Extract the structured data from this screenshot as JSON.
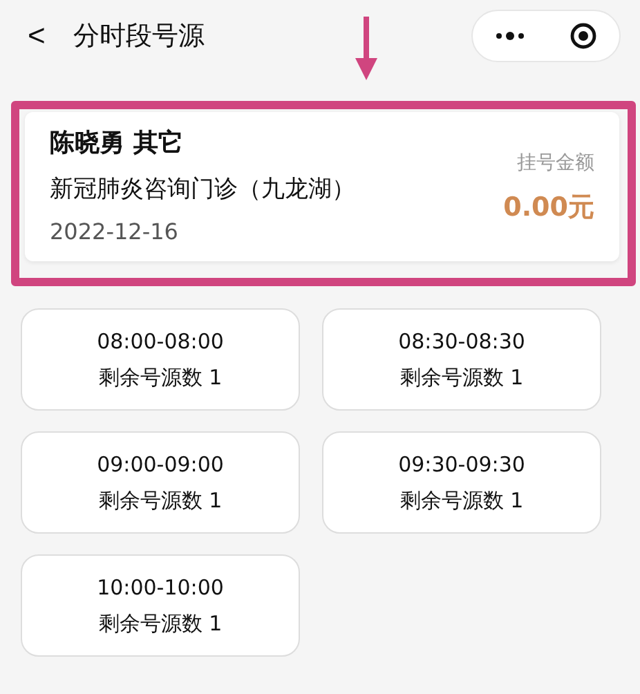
{
  "header": {
    "back": "<",
    "title": "分时段号源"
  },
  "card": {
    "name": "陈晓勇 其它",
    "department": "新冠肺炎咨询门诊（九龙湖）",
    "date": "2022-12-16",
    "fee_label": "挂号金额",
    "fee": "0.00元"
  },
  "slots": [
    {
      "time": "08:00-08:00",
      "remaining": "剩余号源数 1"
    },
    {
      "time": "08:30-08:30",
      "remaining": "剩余号源数 1"
    },
    {
      "time": "09:00-09:00",
      "remaining": "剩余号源数 1"
    },
    {
      "time": "09:30-09:30",
      "remaining": "剩余号源数 1"
    },
    {
      "time": "10:00-10:00",
      "remaining": "剩余号源数 1"
    }
  ]
}
